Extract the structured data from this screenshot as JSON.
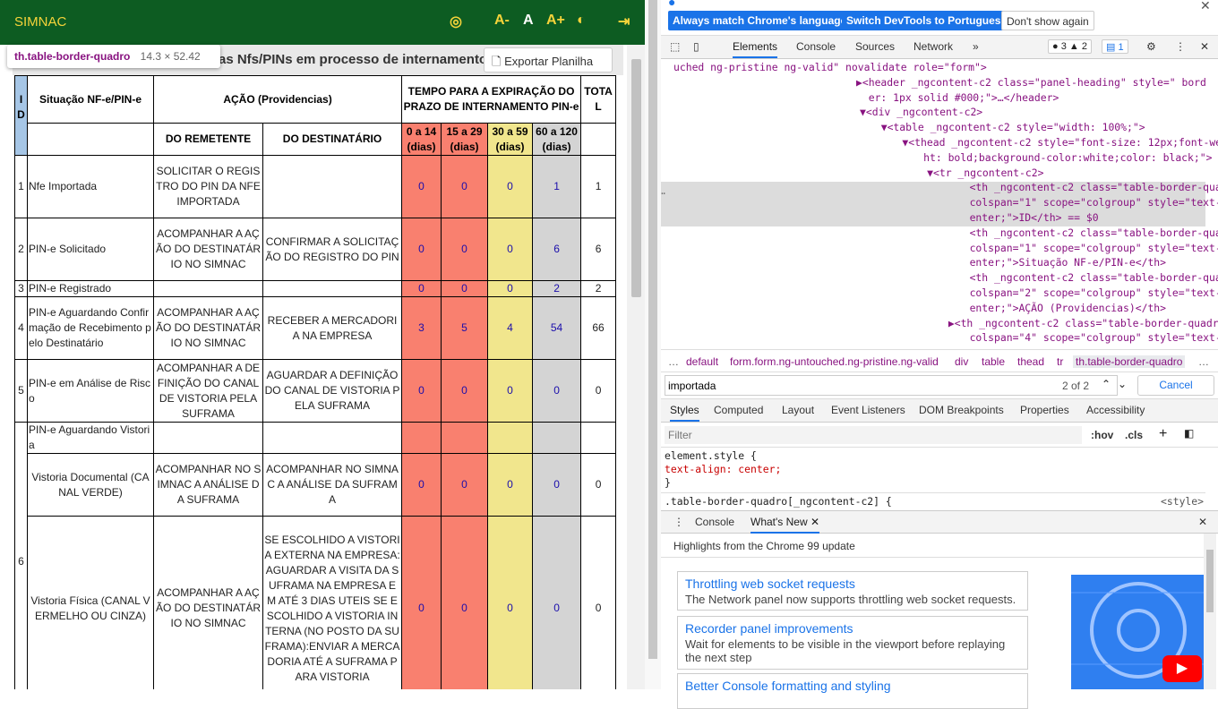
{
  "app": {
    "brand": "SIMNAC",
    "font_buttons": [
      "A-",
      "A",
      "A+"
    ]
  },
  "tooltip": {
    "selector": "th.table-border-quadro",
    "size": "14.3 × 52.42"
  },
  "panel": {
    "title": "as Nfs/PINs em processo de internamento",
    "export_label": "Exportar Planilha"
  },
  "table": {
    "head": {
      "id": "ID",
      "situacao": "Situação NF-e/PIN-e",
      "acao": "AÇÃO (Providencias)",
      "tempo": "TEMPO PARA A EXPIRAÇÃO DO PRAZO DE INTERNAMENTO PIN-e",
      "total": "TOTAL",
      "remetente": "DO REMETENTE",
      "destinatario": "DO DESTINATÁRIO",
      "p1": "0 a 14 (dias)",
      "p2": "15 a 29 (dias)",
      "p3": "30 a 59 (dias)",
      "p4": "60 a 120 (dias)"
    },
    "rows": [
      {
        "id": "1",
        "sit": "Nfe Importada",
        "rem": "SOLICITAR O REGISTRO DO PIN DA NFE IMPORTADA",
        "dest": "",
        "v": [
          "0",
          "0",
          "0",
          "1"
        ],
        "total": "1"
      },
      {
        "id": "2",
        "sit": "PIN-e Solicitado",
        "rem": "ACOMPANHAR A AÇÃO DO DESTINATÁRIO NO SIMNAC",
        "dest": "CONFIRMAR A SOLICITAÇÃO DO REGISTRO DO PIN",
        "v": [
          "0",
          "0",
          "0",
          "6"
        ],
        "total": "6"
      },
      {
        "id": "3",
        "sit": "PIN-e Registrado",
        "rem": "",
        "dest": "",
        "v": [
          "0",
          "0",
          "0",
          "2"
        ],
        "total": "2"
      },
      {
        "id": "4",
        "sit": "PIN-e Aguardando Confirmação de Recebimento pelo Destinatário",
        "rem": "ACOMPANHAR A AÇÃO DO DESTINATÁRIO NO SIMNAC",
        "dest": "RECEBER A MERCADORIA NA EMPRESA",
        "v": [
          "3",
          "5",
          "4",
          "54"
        ],
        "total": "66"
      },
      {
        "id": "5",
        "sit": "PIN-e em Análise de Risco",
        "rem": "ACOMPANHAR A DEFINIÇÃO DO CANAL DE VISTORIA PELA SUFRAMA",
        "dest": "AGUARDAR A DEFINIÇÃO DO CANAL DE VISTORIA PELA SUFRAMA",
        "v": [
          "0",
          "0",
          "0",
          "0"
        ],
        "total": "0"
      }
    ],
    "row6": {
      "id": "6",
      "sit": "PIN-e Aguardando Vistoria",
      "doc": {
        "sit": "Vistoria Documental (CANAL VERDE)",
        "rem": "ACOMPANHAR NO SIMNAC A ANÁLISE DA SUFRAMA",
        "dest": "ACOMPANHAR NO SIMNAC A ANÁLISE DA SUFRAMA",
        "v": [
          "0",
          "0",
          "0",
          "0"
        ],
        "total": "0"
      },
      "fis": {
        "sit": "Vistoria Física (CANAL VERMELHO OU CINZA)",
        "rem": "ACOMPANHAR A AÇÃO DO DESTINATÁRIO NO SIMNAC",
        "dest": "SE ESCOLHIDO A VISTORIA EXTERNA NA EMPRESA: AGUARDAR A VISITA DA SUFRAMA NA EMPRESA EM ATÉ 3 DIAS UTEIS SE ESCOLHIDO A VISTORIA INTERNA (NO POSTO DA SUFRAMA):ENVIAR A MERCADORIA ATÉ A SUFRAMA PARA VISTORIA",
        "v": [
          "0",
          "0",
          "0",
          "0"
        ],
        "total": "0"
      }
    }
  },
  "devtools": {
    "infobar": {
      "b1": "Always match Chrome's language",
      "b2": "Switch DevTools to Portuguese",
      "b3": "Don't show again"
    },
    "tabs": [
      "Elements",
      "Console",
      "Sources",
      "Network"
    ],
    "errors": "3",
    "warnings": "2",
    "messages": "1",
    "code": [
      "uched ng-pristine ng-valid\" novalidate role=\"form\">",
      "▶<header _ngcontent-c2 class=\"panel-heading\" style=\" bord",
      "  er: 1px solid #000;\">…</header>",
      "▼<div _ngcontent-c2>",
      "  ▼<table _ngcontent-c2 style=\"width: 100%;\">",
      "    ▼<thead _ngcontent-c2 style=\"font-size: 12px;font-weig",
      "      ht: bold;background-color:white;color: black;\">",
      "      ▼<tr _ngcontent-c2>",
      "          <th _ngcontent-c2 class=\"table-border-quadro\"",
      "          colspan=\"1\" scope=\"colgroup\" style=\"text-align: c",
      "          enter;\">ID</th> == $0",
      "          <th _ngcontent-c2 class=\"table-border-quadro\"",
      "          colspan=\"1\" scope=\"colgroup\" style=\"text-align: c",
      "          enter;\">Situação NF-e/PIN-e</th>",
      "          <th _ngcontent-c2 class=\"table-border-quadro\"",
      "          colspan=\"2\" scope=\"colgroup\" style=\"text-align: c",
      "          enter;\">AÇÃO (Providencias)</th>",
      "        ▶<th _ngcontent-c2 class=\"table-border-quadro\"",
      "          colspan=\"4\" scope=\"colgroup\" style=\"text-align: c"
    ],
    "crumbs": [
      "default",
      "form.form.ng-untouched.ng-pristine.ng-valid",
      "div",
      "table",
      "thead",
      "tr",
      "th.table-border-quadro"
    ],
    "search": {
      "value": "importada",
      "count": "2 of 2",
      "cancel": "Cancel"
    },
    "subtabs": [
      "Styles",
      "Computed",
      "Layout",
      "Event Listeners",
      "DOM Breakpoints",
      "Properties",
      "Accessibility"
    ],
    "filter_placeholder": "Filter",
    "hov": ":hov",
    "cls": ".cls",
    "styles": {
      "l1": "element.style {",
      "l2": "  text-align: center;",
      "l3": "}",
      "l4": ".table-border-quadro[_ngcontent-c2] {",
      "src": "<style>"
    },
    "drawer": {
      "console": "Console",
      "whatsnew": "What's New"
    },
    "highlights": "Highlights from the Chrome 99 update",
    "cards": [
      {
        "h": "Throttling web socket requests",
        "p": "The Network panel now supports throttling web socket requests."
      },
      {
        "h": "Recorder panel improvements",
        "p": "Wait for elements to be visible in the viewport before replaying the next step"
      },
      {
        "h": "Better Console formatting and styling",
        "p": ""
      }
    ]
  }
}
